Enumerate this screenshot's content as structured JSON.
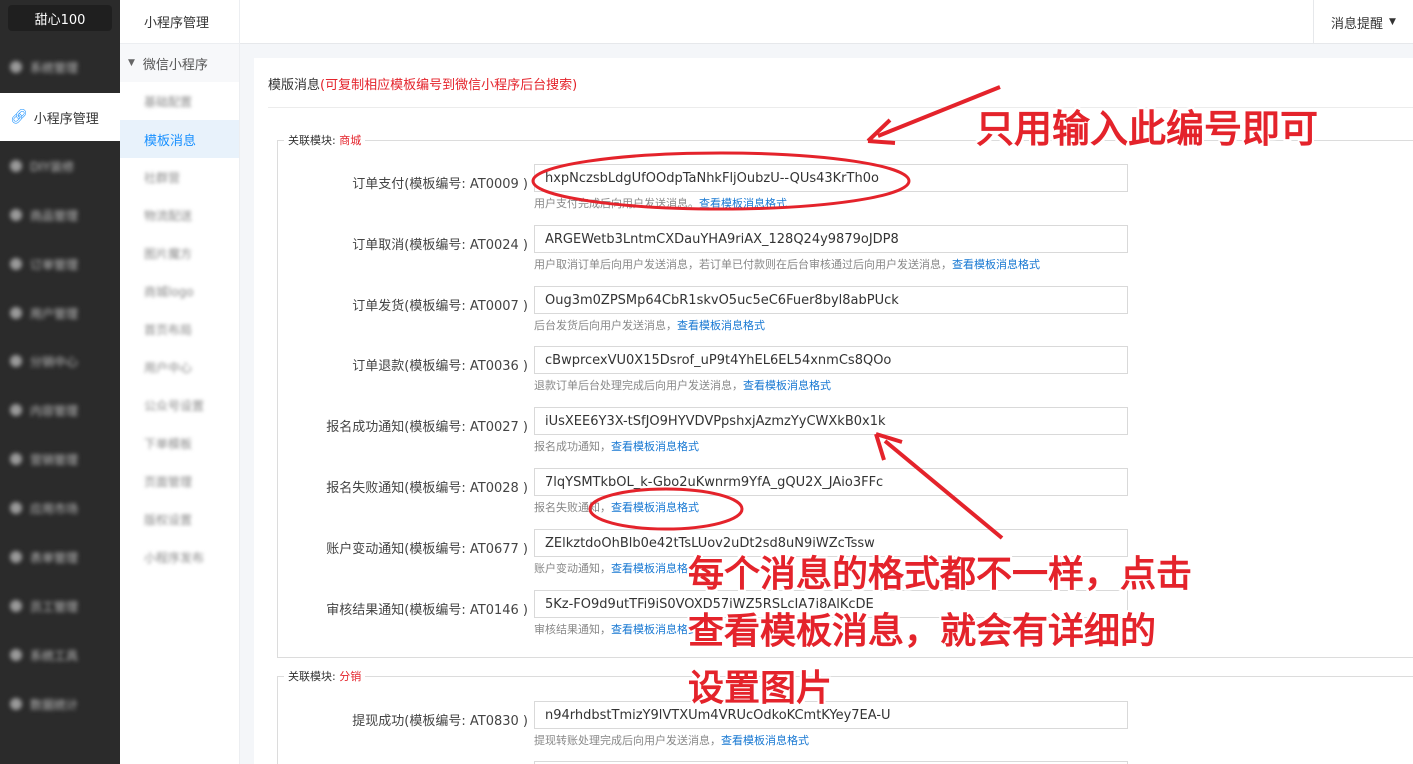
{
  "sidebar": {
    "brand": "甜心100",
    "items": [
      "系统管理",
      "小程序管理",
      "DIY装修",
      "商品管理",
      "订单管理",
      "用户管理",
      "分销中心",
      "内容管理",
      "营销管理",
      "应用市场",
      "表单管理",
      "员工管理",
      "系统工具",
      "数据统计"
    ],
    "active_label": "小程序管理"
  },
  "subnav": {
    "title": "小程序管理",
    "group": "微信小程序",
    "items": [
      "基础配置",
      "模板消息",
      "社群营",
      "物流配送",
      "图片魔方",
      "商城logo",
      "首页布局",
      "用户中心",
      "公众号设置",
      "下单模板",
      "页面管理",
      "版权设置",
      "小程序发布"
    ]
  },
  "topbar": {
    "notice": "消息提醒"
  },
  "section": {
    "title": "模版消息",
    "title_hint": "(可复制相应模板编号到微信小程序后台搜索)"
  },
  "modules": [
    {
      "legend": "关联模块:",
      "name": "商城",
      "rows": [
        {
          "label": "订单支付(模板编号: AT0009 )",
          "value": "hxpNczsbLdgUfOOdpTaNhkFljOubzU--QUs43KrTh0o",
          "help": "用户支付完成后向用户发送消息。",
          "link": "查看模板消息格式"
        },
        {
          "label": "订单取消(模板编号: AT0024 )",
          "value": "ARGEWetb3LntmCXDauYHA9riAX_128Q24y9879oJDP8",
          "help": "用户取消订单后向用户发送消息，若订单已付款则在后台审核通过后向用户发送消息，",
          "link": "查看模板消息格式"
        },
        {
          "label": "订单发货(模板编号: AT0007 )",
          "value": "Oug3m0ZPSMp64CbR1skvO5uc5eC6Fuer8byl8abPUck",
          "help": "后台发货后向用户发送消息，",
          "link": "查看模板消息格式"
        },
        {
          "label": "订单退款(模板编号: AT0036 )",
          "value": "cBwprcexVU0X15Dsrof_uP9t4YhEL6EL54xnmCs8QOo",
          "help": "退款订单后台处理完成后向用户发送消息，",
          "link": "查看模板消息格式"
        },
        {
          "label": "报名成功通知(模板编号: AT0027 )",
          "value": "iUsXEE6Y3X-tSfJO9HYVDVPpshxjAzmzYyCWXkB0x1k",
          "help": "报名成功通知，",
          "link": "查看模板消息格式"
        },
        {
          "label": "报名失败通知(模板编号: AT0028 )",
          "value": "7lqYSMTkbOL_k-Gbo2uKwnrm9YfA_gQU2X_JAio3FFc",
          "help": "报名失败通知，",
          "link": "查看模板消息格式"
        },
        {
          "label": "账户变动通知(模板编号: AT0677 )",
          "value": "ZElkztdoOhBlb0e42tTsLUov2uDt2sd8uN9iWZcTssw",
          "help": "账户变动通知，",
          "link": "查看模板消息格式"
        },
        {
          "label": "审核结果通知(模板编号: AT0146 )",
          "value": "5Kz-FO9d9utTFi9iS0VOXD57iWZ5RSLcIA7i8AlKcDE",
          "help": "审核结果通知，",
          "link": "查看模板消息格式"
        }
      ]
    },
    {
      "legend": "关联模块:",
      "name": "分销",
      "rows": [
        {
          "label": "提现成功(模板编号: AT0830 )",
          "value": "n94rhdbstTmizY9lVTXUm4VRUcOdkoKCmtKYey7EA-U",
          "help": "提现转账处理完成后向用户发送消息，",
          "link": "查看模板消息格式"
        }
      ]
    }
  ],
  "annotations": {
    "note1": "只用输入此编号即可",
    "note2_line1": "每个消息的格式都不一样，点击",
    "note2_line2": "查看模板消息，就会有详细的",
    "note2_line3": "设置图片",
    "color": "#e4232b"
  }
}
